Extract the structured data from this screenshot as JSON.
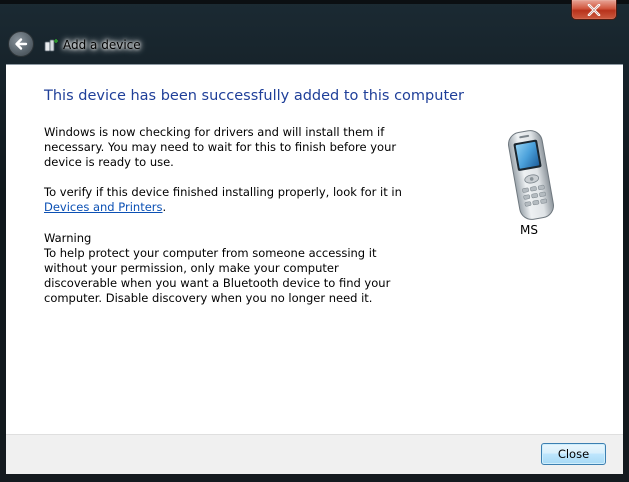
{
  "wizard": {
    "title": "Add a device"
  },
  "content": {
    "heading": "This device has been successfully added to this computer",
    "paragraph1": "Windows is now checking for drivers and will install them if necessary. You may need to wait for this to finish before your device is ready to use.",
    "paragraph2_prefix": "To verify if this device finished installing properly, look for it in",
    "paragraph2_link": "Devices and Printers",
    "paragraph2_suffix": ".",
    "warning_heading": "Warning",
    "warning_body": "To help protect your computer from someone accessing it without your permission, only make your computer discoverable when you want a Bluetooth device to find your computer. Disable discovery when you no longer need it."
  },
  "device": {
    "name": "MS",
    "icon": "mobile-phone-icon"
  },
  "footer": {
    "close_label": "Close"
  },
  "icons": {
    "window_close": "close-icon",
    "back": "back-arrow-icon",
    "wizard": "add-device-icon"
  },
  "colors": {
    "heading": "#1f3f99",
    "link": "#0b50b4",
    "window_close": "#c7402a"
  }
}
